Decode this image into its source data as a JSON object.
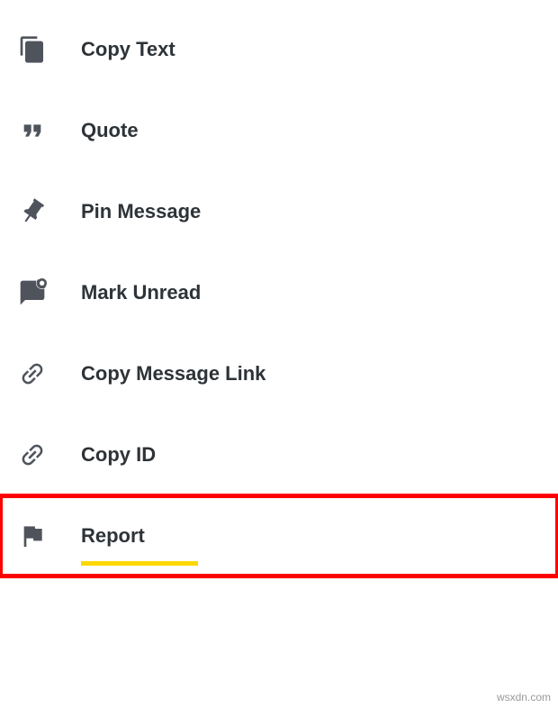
{
  "menu": {
    "items": [
      {
        "label": "Copy Text",
        "icon": "copy"
      },
      {
        "label": "Quote",
        "icon": "quote"
      },
      {
        "label": "Pin Message",
        "icon": "pin"
      },
      {
        "label": "Mark Unread",
        "icon": "unread"
      },
      {
        "label": "Copy Message Link",
        "icon": "link"
      },
      {
        "label": "Copy ID",
        "icon": "link"
      },
      {
        "label": "Report",
        "icon": "flag"
      }
    ]
  },
  "watermark": "wsxdn.com"
}
